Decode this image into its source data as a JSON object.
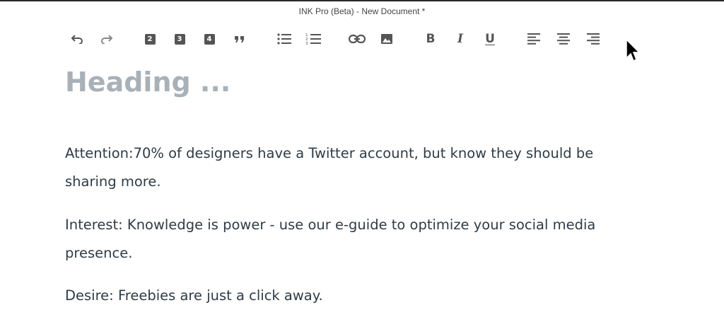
{
  "window": {
    "title": "INK Pro (Beta) - New Document *"
  },
  "toolbar": {
    "h2_label": "2",
    "h3_label": "3",
    "h4_label": "4",
    "quote_label": "❞",
    "bold_label": "B",
    "italic_label": "I",
    "underline_label": "U",
    "icons": [
      "undo-icon",
      "redo-icon",
      "heading-2-icon",
      "heading-3-icon",
      "heading-4-icon",
      "quote-icon",
      "bulleted-list-icon",
      "numbered-list-icon",
      "link-icon",
      "image-icon",
      "bold-icon",
      "italic-icon",
      "underline-icon",
      "align-left-icon",
      "align-center-icon",
      "align-right-icon"
    ]
  },
  "editor": {
    "heading_placeholder": "Heading ...",
    "paragraphs": [
      "Attention:70% of designers have a Twitter account, but know they should be sharing more.",
      "Interest: Knowledge is power - use our e-guide to optimize your social media presence.",
      "Desire: Freebies are just a click away."
    ]
  },
  "colors": {
    "heading_placeholder": "#a9b1b8",
    "body_text": "#2f3b45",
    "toolbar_icon": "#555555"
  }
}
